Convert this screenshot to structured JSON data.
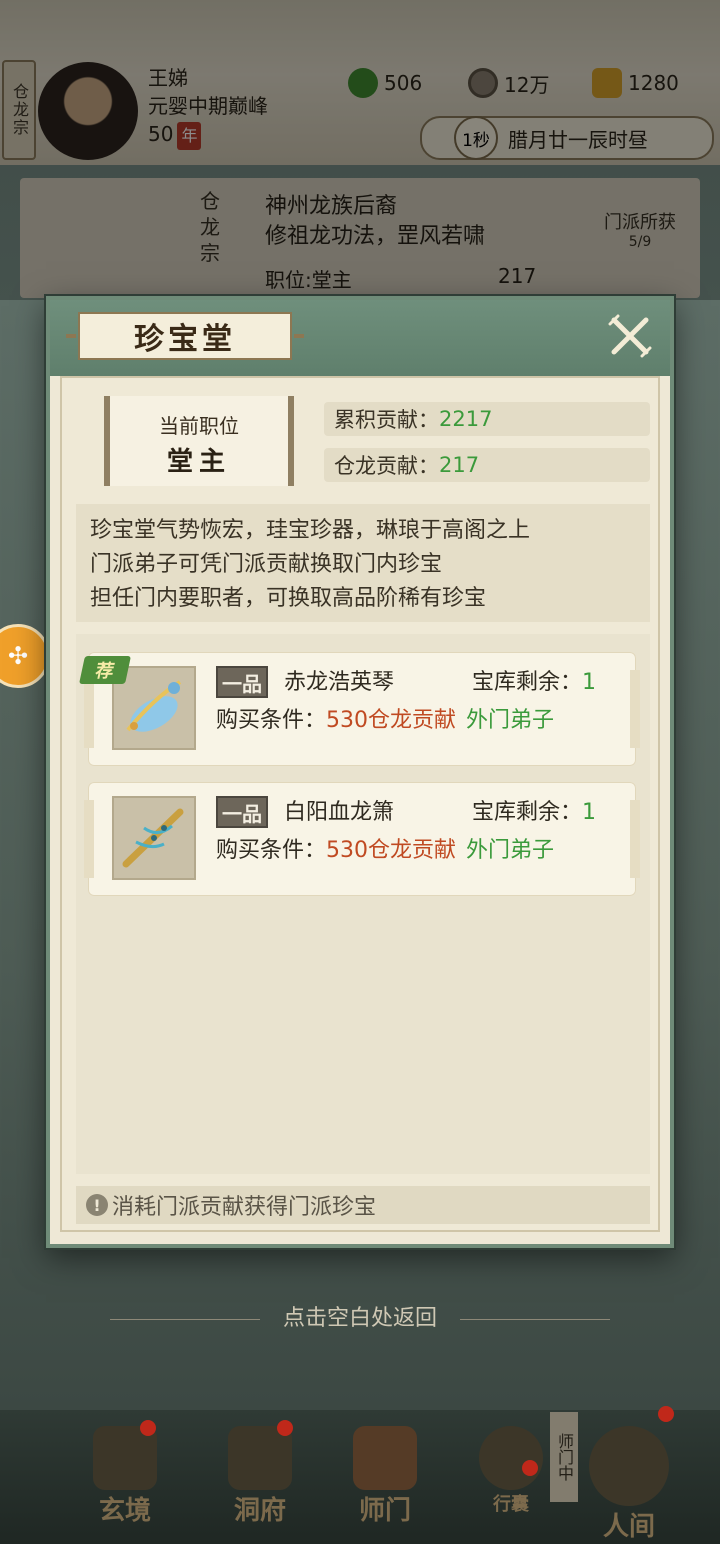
{
  "player": {
    "sect_tag": "仓龙宗",
    "name": "王娣",
    "realm": "元婴中期巅峰",
    "age": "50",
    "age_unit": "年"
  },
  "resources": [
    {
      "icon": "jade-leaf-icon",
      "value": "506"
    },
    {
      "icon": "coin-icon",
      "value": "12万"
    },
    {
      "icon": "ingot-icon",
      "value": "1280"
    }
  ],
  "time": {
    "speed": "1秒",
    "date": "腊月廿一辰时昼"
  },
  "sect_card": {
    "lines": [
      "神州龙族后裔",
      "修祖龙功法，罡风若啸"
    ],
    "gain_label": "门派所获",
    "gain_count": "5/9",
    "position": "职位:堂主",
    "currency": "217",
    "vertical_name": "仓龙宗"
  },
  "modal": {
    "title": "珍宝堂",
    "current_position_label": "当前职位",
    "current_position": "堂主",
    "stats": [
      {
        "label": "累积贡献：",
        "value": "2217"
      },
      {
        "label": "仓龙贡献：",
        "value": "217"
      }
    ],
    "description": [
      "珍宝堂气势恢宏，珪宝珍器，琳琅于高阁之上",
      "门派弟子可凭门派贡献换取门内珍宝",
      "担任门内要职者，可换取高品阶稀有珍宝"
    ],
    "items": [
      {
        "recommended": true,
        "badge": "荐",
        "grade": "一品",
        "name": "赤龙浩英琴",
        "stock_label": "宝库剩余：",
        "stock": "1",
        "cond_label": "购买条件：",
        "cost": "530仓龙贡献",
        "rank": "外门弟子"
      },
      {
        "recommended": false,
        "badge": "",
        "grade": "一品",
        "name": "白阳血龙箫",
        "stock_label": "宝库剩余：",
        "stock": "1",
        "cond_label": "购买条件：",
        "cost": "530仓龙贡献",
        "rank": "外门弟子"
      }
    ],
    "tip": "消耗门派贡献获得门派珍宝"
  },
  "return_hint": "点击空白处返回",
  "nav": [
    {
      "label": "玄境",
      "badge": true
    },
    {
      "label": "洞府",
      "badge": true
    },
    {
      "label": "师门",
      "badge": false
    },
    {
      "label": "行囊",
      "badge": true
    },
    {
      "label": "人间",
      "badge": true
    }
  ],
  "mentor_badge": "师门中",
  "colors": {
    "accent_green": "#3b9a3b",
    "cost_red": "#c04a22",
    "modal_frame": "#6f8b78",
    "parchment": "#eee8d6"
  }
}
